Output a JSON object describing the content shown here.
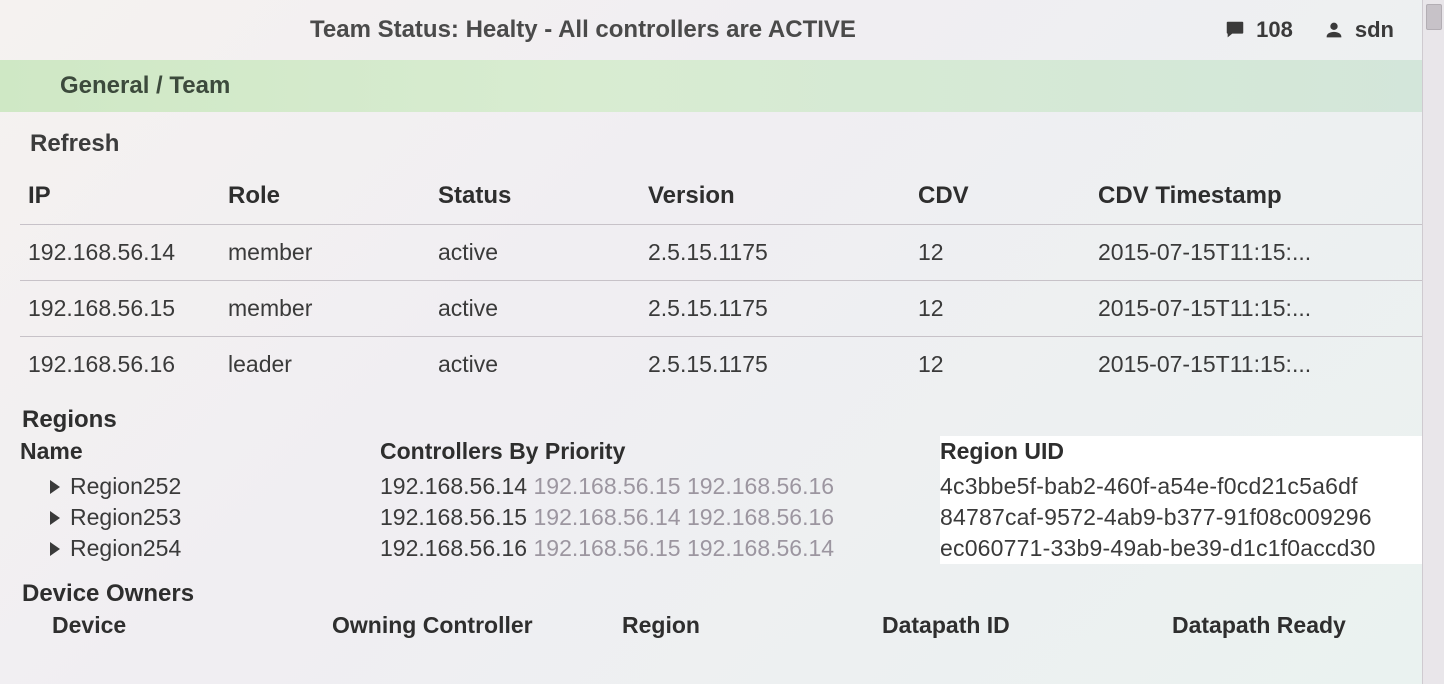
{
  "topbar": {
    "status_text": "Team Status: Healty - All controllers are ACTIVE",
    "alert_count": "108",
    "user_name": "sdn"
  },
  "breadcrumb": "General / Team",
  "refresh_label": "Refresh",
  "controllers": {
    "headers": {
      "ip": "IP",
      "role": "Role",
      "status": "Status",
      "version": "Version",
      "cdv": "CDV",
      "cdv_ts": "CDV Timestamp"
    },
    "rows": [
      {
        "ip": "192.168.56.14",
        "role": "member",
        "status": "active",
        "version": "2.5.15.1175",
        "cdv": "12",
        "cdv_ts": "2015-07-15T11:15:..."
      },
      {
        "ip": "192.168.56.15",
        "role": "member",
        "status": "active",
        "version": "2.5.15.1175",
        "cdv": "12",
        "cdv_ts": "2015-07-15T11:15:..."
      },
      {
        "ip": "192.168.56.16",
        "role": "leader",
        "status": "active",
        "version": "2.5.15.1175",
        "cdv": "12",
        "cdv_ts": "2015-07-15T11:15:..."
      }
    ]
  },
  "regions": {
    "title": "Regions",
    "headers": {
      "name": "Name",
      "cbp": "Controllers By Priority",
      "uid": "Region UID"
    },
    "rows": [
      {
        "name": "Region252",
        "prio": [
          "192.168.56.14",
          "192.168.56.15",
          "192.168.56.16"
        ],
        "uid": "4c3bbe5f-bab2-460f-a54e-f0cd21c5a6df"
      },
      {
        "name": "Region253",
        "prio": [
          "192.168.56.15",
          "192.168.56.14",
          "192.168.56.16"
        ],
        "uid": "84787caf-9572-4ab9-b377-91f08c009296"
      },
      {
        "name": "Region254",
        "prio": [
          "192.168.56.16",
          "192.168.56.15",
          "192.168.56.14"
        ],
        "uid": "ec060771-33b9-49ab-be39-d1c1f0accd30"
      }
    ]
  },
  "device_owners": {
    "title": "Device Owners",
    "headers": {
      "device": "Device",
      "owning": "Owning Controller",
      "region": "Region",
      "dpid": "Datapath ID",
      "ready": "Datapath Ready"
    }
  }
}
